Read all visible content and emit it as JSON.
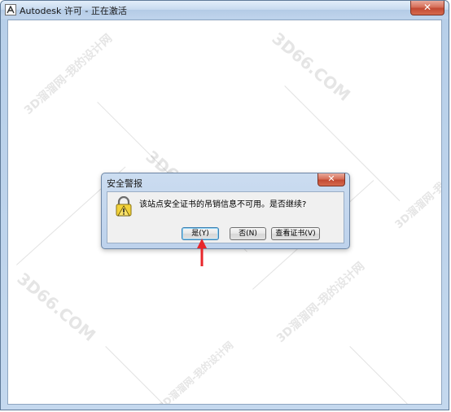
{
  "window": {
    "title": "Autodesk 许可 - 正在激活",
    "icon": "autodesk-a-icon",
    "close_glyph": "✕",
    "frame_color": "#b9cfe8",
    "close_color": "#c9503a"
  },
  "watermark": {
    "site": "3D66.COM",
    "slogan": "3D溜溜网-我的设计网"
  },
  "dialog": {
    "title": "安全警报",
    "close_glyph": "✕",
    "message": "该站点安全证书的吊销信息不可用。是否继续?",
    "icon": "security-warning-lock-icon",
    "buttons": {
      "yes": "是(Y)",
      "no": "否(N)",
      "view_cert": "查看证书(V)"
    }
  },
  "annotation": {
    "icon": "red-arrow-up-icon",
    "color": "#e8262a"
  }
}
